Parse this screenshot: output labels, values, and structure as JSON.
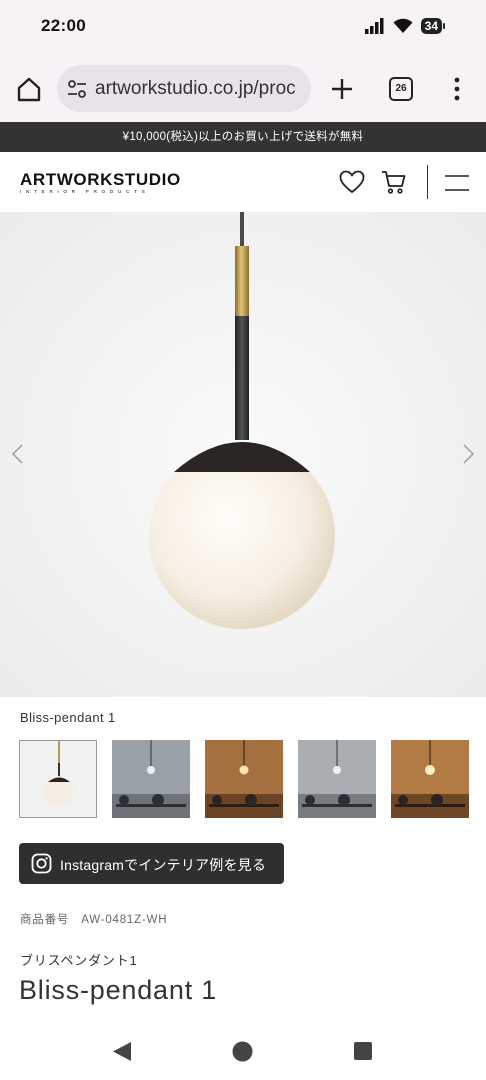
{
  "status_bar": {
    "time": "22:00",
    "battery": "34"
  },
  "browser": {
    "url": "artworkstudio.co.jp/proc",
    "tab_count": "26"
  },
  "banner": {
    "text": "¥10,000(税込)以上のお買い上げで送料が無料"
  },
  "header": {
    "logo_main": "ARTWORKSTUDIO",
    "logo_sub": "INTERIOR PRODUCTS"
  },
  "product": {
    "image_caption": "Bliss-pendant 1",
    "thumbnails": [
      "lamp-white-background",
      "dining-room-grey",
      "dining-room-warm",
      "dining-room-grey-2",
      "dining-room-warm-2"
    ],
    "instagram_label": "Instagramでインテリア例を見る",
    "sku_label": "商品番号",
    "sku_value": "AW-0481Z-WH",
    "name_kana": "ブリスペンダント1",
    "name": "Bliss-pendant 1"
  },
  "colors": {
    "banner_bg": "#333333",
    "button_bg": "#2f2f2f",
    "chrome_bg": "#f7f2f6"
  }
}
